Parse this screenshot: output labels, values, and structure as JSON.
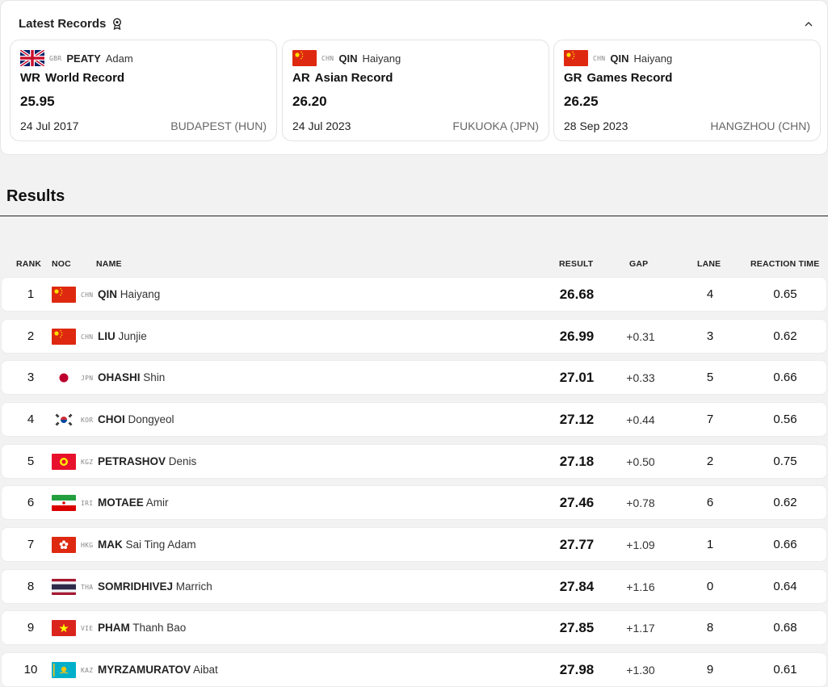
{
  "latest_records": {
    "title": "Latest Records",
    "cards": [
      {
        "noc": "GBR",
        "surname": "PEATY",
        "given": "Adam",
        "record_abbr": "WR",
        "record_name": "World Record",
        "time": "25.95",
        "date": "24 Jul 2017",
        "venue": "BUDAPEST (HUN)",
        "flag": "gbr-flag-icon"
      },
      {
        "noc": "CHN",
        "surname": "QIN",
        "given": "Haiyang",
        "record_abbr": "AR",
        "record_name": "Asian Record",
        "time": "26.20",
        "date": "24 Jul 2023",
        "venue": "FUKUOKA (JPN)",
        "flag": "chn-flag-icon"
      },
      {
        "noc": "CHN",
        "surname": "QIN",
        "given": "Haiyang",
        "record_abbr": "GR",
        "record_name": "Games Record",
        "time": "26.25",
        "date": "28 Sep 2023",
        "venue": "HANGZHOU (CHN)",
        "flag": "chn-flag-icon"
      }
    ]
  },
  "results": {
    "title": "Results",
    "headers": {
      "rank": "RANK",
      "noc": "NOC",
      "name": "NAME",
      "result": "RESULT",
      "gap": "GAP",
      "lane": "LANE",
      "reaction": "REACTION TIME"
    },
    "rows": [
      {
        "rank": "1",
        "noc": "CHN",
        "surname": "QIN",
        "given": "Haiyang",
        "result": "26.68",
        "gap": "",
        "lane": "4",
        "reaction": "0.65"
      },
      {
        "rank": "2",
        "noc": "CHN",
        "surname": "LIU",
        "given": "Junjie",
        "result": "26.99",
        "gap": "+0.31",
        "lane": "3",
        "reaction": "0.62"
      },
      {
        "rank": "3",
        "noc": "JPN",
        "surname": "OHASHI",
        "given": "Shin",
        "result": "27.01",
        "gap": "+0.33",
        "lane": "5",
        "reaction": "0.66"
      },
      {
        "rank": "4",
        "noc": "KOR",
        "surname": "CHOI",
        "given": "Dongyeol",
        "result": "27.12",
        "gap": "+0.44",
        "lane": "7",
        "reaction": "0.56"
      },
      {
        "rank": "5",
        "noc": "KGZ",
        "surname": "PETRASHOV",
        "given": "Denis",
        "result": "27.18",
        "gap": "+0.50",
        "lane": "2",
        "reaction": "0.75"
      },
      {
        "rank": "6",
        "noc": "IRI",
        "surname": "MOTAEE",
        "given": "Amir",
        "result": "27.46",
        "gap": "+0.78",
        "lane": "6",
        "reaction": "0.62"
      },
      {
        "rank": "7",
        "noc": "HKG",
        "surname": "MAK",
        "given": "Sai Ting Adam",
        "result": "27.77",
        "gap": "+1.09",
        "lane": "1",
        "reaction": "0.66"
      },
      {
        "rank": "8",
        "noc": "THA",
        "surname": "SOMRIDHIVEJ",
        "given": "Marrich",
        "result": "27.84",
        "gap": "+1.16",
        "lane": "0",
        "reaction": "0.64"
      },
      {
        "rank": "9",
        "noc": "VIE",
        "surname": "PHAM",
        "given": "Thanh Bao",
        "result": "27.85",
        "gap": "+1.17",
        "lane": "8",
        "reaction": "0.68"
      },
      {
        "rank": "10",
        "noc": "KAZ",
        "surname": "MYRZAMURATOV",
        "given": "Aibat",
        "result": "27.98",
        "gap": "+1.30",
        "lane": "9",
        "reaction": "0.61"
      }
    ]
  }
}
